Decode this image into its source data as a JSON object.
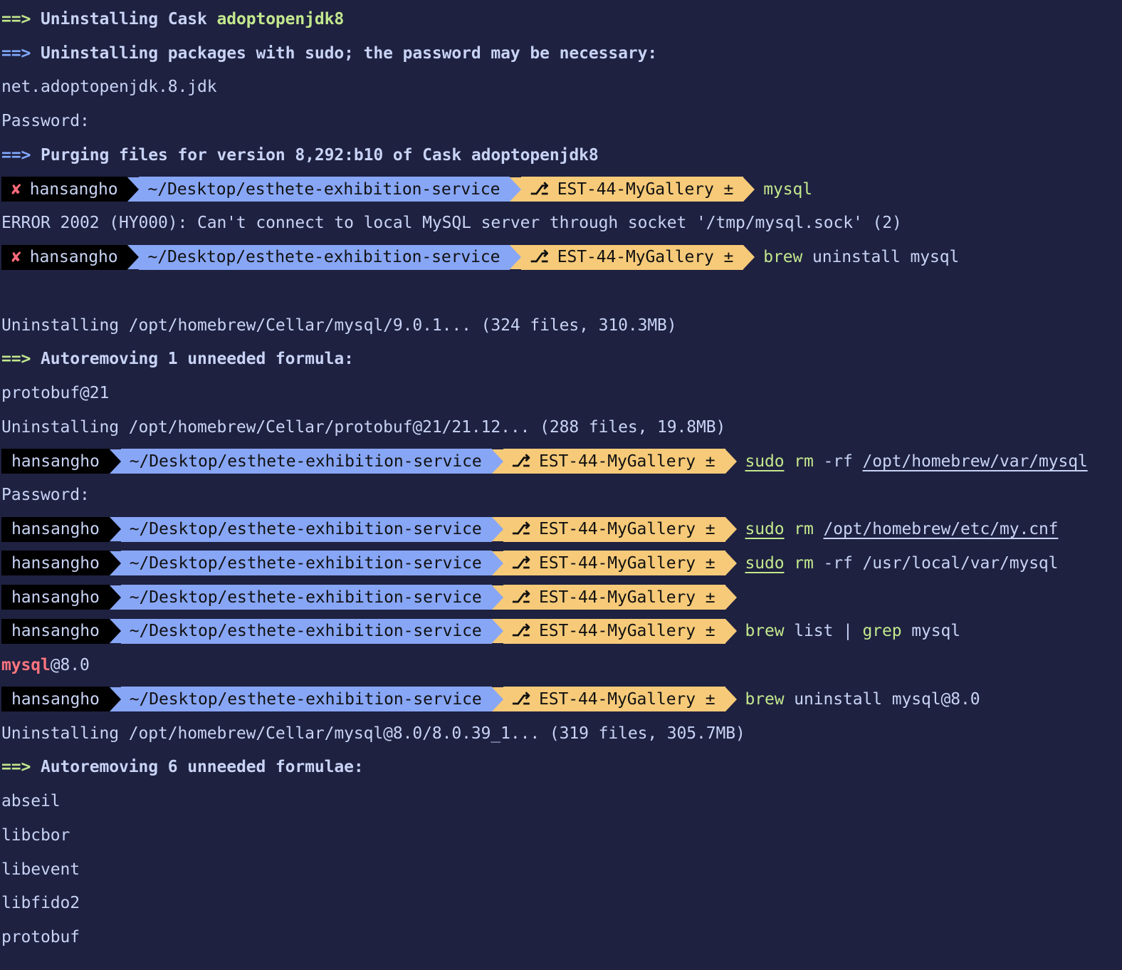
{
  "colors": {
    "fg": "#c8d3f5",
    "green": "#c3e88d",
    "blue": "#82aaff",
    "red": "#ff757f",
    "bg": "#1e2140"
  },
  "prompt": {
    "user": "hansangho",
    "path": "~/Desktop/esthete-exhibition-service",
    "branch": "EST-44-MyGallery ±",
    "error_icon": "✘",
    "branch_icon": "⎇"
  },
  "lines": [
    {
      "spans": [
        {
          "t": "==> ",
          "c": "green",
          "b": 1
        },
        {
          "t": "Uninstalling Cask ",
          "b": 1
        },
        {
          "t": "adoptopenjdk8",
          "c": "green",
          "b": 1
        }
      ]
    },
    {
      "spans": [
        {
          "t": "==> ",
          "c": "blue",
          "b": 1
        },
        {
          "t": "Uninstalling packages with sudo; the password may be necessary:",
          "b": 1
        }
      ]
    },
    {
      "spans": [
        {
          "t": "net.adoptopenjdk.8.jdk"
        }
      ]
    },
    {
      "spans": [
        {
          "t": "Password:"
        }
      ]
    },
    {
      "spans": [
        {
          "t": "==> ",
          "c": "blue",
          "b": 1
        },
        {
          "t": "Purging files for version 8,292:b10 of Cask adoptopenjdk8",
          "b": 1
        }
      ]
    },
    {
      "prompt": true,
      "error": true,
      "spans": [
        {
          "t": "mysql",
          "c": "green"
        }
      ]
    },
    {
      "spans": [
        {
          "t": "ERROR 2002 (HY000): Can't connect to local MySQL server through socket '/tmp/mysql.sock' (2)"
        }
      ]
    },
    {
      "prompt": true,
      "error": true,
      "spans": [
        {
          "t": "brew",
          "c": "green"
        },
        {
          "t": " uninstall mysql"
        }
      ]
    },
    {
      "spans": []
    },
    {
      "spans": [
        {
          "t": "Uninstalling /opt/homebrew/Cellar/mysql/9.0.1... (324 files, 310.3MB)"
        }
      ]
    },
    {
      "spans": [
        {
          "t": "==> ",
          "c": "green",
          "b": 1
        },
        {
          "t": "Autoremoving 1 unneeded formula:",
          "b": 1
        }
      ]
    },
    {
      "spans": [
        {
          "t": "protobuf@21"
        }
      ]
    },
    {
      "spans": [
        {
          "t": "Uninstalling /opt/homebrew/Cellar/protobuf@21/21.12... (288 files, 19.8MB)"
        }
      ]
    },
    {
      "prompt": true,
      "spans": [
        {
          "t": "sudo",
          "c": "green",
          "u": 1
        },
        {
          "t": " "
        },
        {
          "t": "rm",
          "c": "green"
        },
        {
          "t": " -rf "
        },
        {
          "t": "/opt/homebrew/var/mysql",
          "u": 1
        }
      ]
    },
    {
      "spans": [
        {
          "t": "Password:"
        }
      ]
    },
    {
      "prompt": true,
      "spans": [
        {
          "t": "sudo",
          "c": "green",
          "u": 1
        },
        {
          "t": " "
        },
        {
          "t": "rm",
          "c": "green"
        },
        {
          "t": " "
        },
        {
          "t": "/opt/homebrew/etc/my.cnf",
          "u": 1
        }
      ]
    },
    {
      "prompt": true,
      "spans": [
        {
          "t": "sudo",
          "c": "green",
          "u": 1
        },
        {
          "t": " "
        },
        {
          "t": "rm",
          "c": "green"
        },
        {
          "t": " -rf /usr/local/var/mysql"
        }
      ]
    },
    {
      "prompt": true,
      "spans": []
    },
    {
      "prompt": true,
      "spans": [
        {
          "t": "brew",
          "c": "green"
        },
        {
          "t": " list | "
        },
        {
          "t": "grep",
          "c": "green"
        },
        {
          "t": " mysql"
        }
      ]
    },
    {
      "spans": [
        {
          "t": "mysql",
          "c": "red",
          "b": 1
        },
        {
          "t": "@8.0"
        }
      ]
    },
    {
      "prompt": true,
      "spans": [
        {
          "t": "brew",
          "c": "green"
        },
        {
          "t": " uninstall mysql@8.0"
        }
      ]
    },
    {
      "spans": [
        {
          "t": "Uninstalling /opt/homebrew/Cellar/mysql@8.0/8.0.39_1... (319 files, 305.7MB)"
        }
      ]
    },
    {
      "spans": [
        {
          "t": "==> ",
          "c": "green",
          "b": 1
        },
        {
          "t": "Autoremoving 6 unneeded formulae:",
          "b": 1
        }
      ]
    },
    {
      "spans": [
        {
          "t": "abseil"
        }
      ]
    },
    {
      "spans": [
        {
          "t": "libcbor"
        }
      ]
    },
    {
      "spans": [
        {
          "t": "libevent"
        }
      ]
    },
    {
      "spans": [
        {
          "t": "libfido2"
        }
      ]
    },
    {
      "spans": [
        {
          "t": "protobuf"
        }
      ]
    }
  ]
}
